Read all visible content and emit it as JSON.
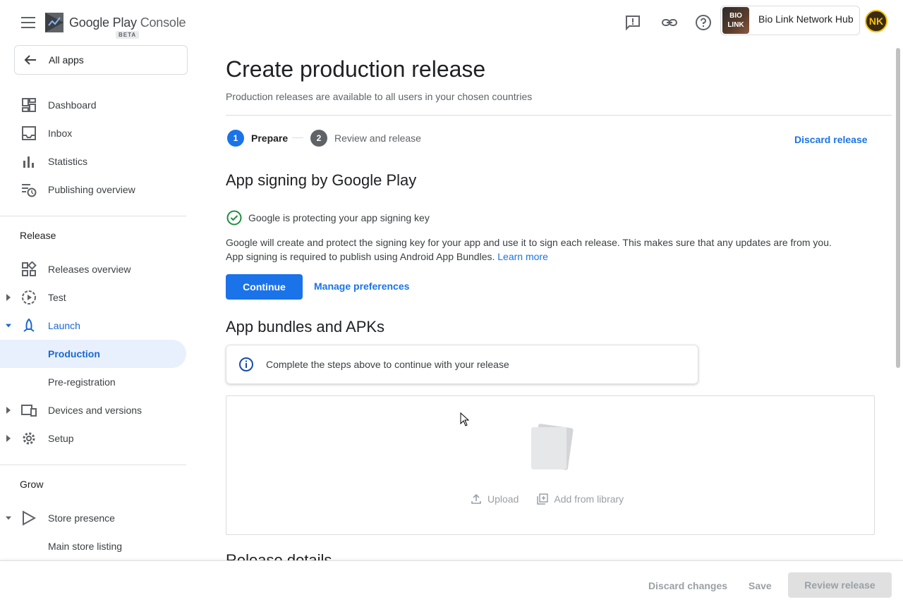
{
  "header": {
    "logo_text": "Google Play",
    "logo_suffix": "Console",
    "beta": "BETA",
    "account_thumb": "BIO LINK",
    "account_name": "Bio Link Network Hub",
    "avatar_initials": "NK"
  },
  "sidebar": {
    "all_apps": "All apps",
    "items_top": [
      {
        "label": "Dashboard",
        "icon": "dashboard-icon"
      },
      {
        "label": "Inbox",
        "icon": "inbox-icon"
      },
      {
        "label": "Statistics",
        "icon": "statistics-icon"
      },
      {
        "label": "Publishing overview",
        "icon": "publishing-overview-icon"
      }
    ],
    "release_header": "Release",
    "release_items": [
      {
        "label": "Releases overview"
      },
      {
        "label": "Test"
      },
      {
        "label": "Launch"
      },
      {
        "label": "Production"
      },
      {
        "label": "Pre-registration"
      },
      {
        "label": "Devices and versions"
      },
      {
        "label": "Setup"
      }
    ],
    "grow_header": "Grow",
    "grow_items": [
      {
        "label": "Store presence"
      },
      {
        "label": "Main store listing"
      }
    ]
  },
  "main": {
    "title": "Create production release",
    "subtitle": "Production releases are available to all users in your chosen countries",
    "steps": [
      {
        "num": "1",
        "label": "Prepare"
      },
      {
        "num": "2",
        "label": "Review and release"
      }
    ],
    "discard_release": "Discard release",
    "signing": {
      "heading": "App signing by Google Play",
      "status": "Google is protecting your app signing key",
      "desc_1": "Google will create and protect the signing key for your app and use it to sign each release. This makes sure that any updates are from you.",
      "desc_2": "App signing is required to publish using Android App Bundles.",
      "learn_more": "Learn more",
      "continue": "Continue",
      "manage": "Manage preferences"
    },
    "bundles": {
      "heading": "App bundles and APKs",
      "info": "Complete the steps above to continue with your release",
      "upload": "Upload",
      "add_library": "Add from library"
    },
    "release_details": "Release details"
  },
  "footer": {
    "discard_changes": "Discard changes",
    "save": "Save",
    "review": "Review release"
  },
  "colors": {
    "accent": "#1a73e8",
    "active_bg": "#e8f0fe",
    "success": "#1e8e3e"
  }
}
